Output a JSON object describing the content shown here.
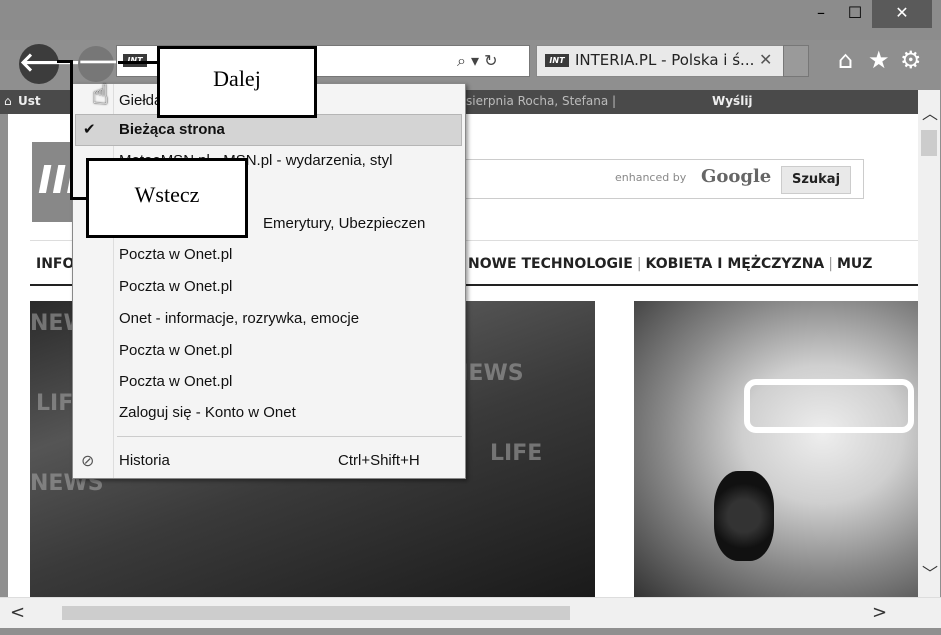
{
  "window": {
    "minimize": "–",
    "maximize": "☐",
    "close": "✕"
  },
  "nav": {
    "back_icon": "🡐",
    "forward_icon": "🡒",
    "addr_favicon": "INT",
    "addr_tools": "⌕ ▾ ↻"
  },
  "tab": {
    "favicon": "INT",
    "title": "INTERIA.PL - Polska i ś...",
    "close": "✕"
  },
  "toolbar_icons": {
    "home": "⌂",
    "favorites": "★",
    "settings": "⚙"
  },
  "favbar": {
    "home_icon": "⌂",
    "label": "Ust",
    "text": "sierpnia  Rocha, Stefana  |",
    "send": "Wyślij"
  },
  "page": {
    "logo": "III",
    "search": {
      "enhanced": "enhanced by",
      "google": "Google",
      "button": "Szukaj"
    },
    "nav_left": "INFO",
    "nav_items": [
      "NOWE TECHNOLOGIE",
      "KOBIETA I MĘŻCZYZNA",
      "MUZ"
    ],
    "photo_marks": [
      "NEWS",
      "LIFE",
      "NEWS",
      "LIFE",
      "NEWS"
    ]
  },
  "menu": {
    "items": [
      "Giełda - INTERIA.PL - giełda,",
      "Bieżąca strona",
      "MotoeMSN.pl - MSN.pl - wydarzenia, styl",
      "",
      "Emerytury, Ubezpieczen",
      "Poczta w Onet.pl",
      "Poczta w Onet.pl",
      "Onet - informacje, rozrywka, emocje",
      "Poczta w Onet.pl",
      "Poczta w Onet.pl",
      "Zaloguj się - Konto w Onet"
    ],
    "check": "✔",
    "history_icon": "⊘",
    "history_label": "Historia",
    "history_shortcut": "Ctrl+Shift+H"
  },
  "callouts": {
    "forward": "Dalej",
    "back": "Wstecz"
  },
  "scroll": {
    "up": "︿",
    "down": "﹀",
    "left": "<",
    "right": ">"
  }
}
